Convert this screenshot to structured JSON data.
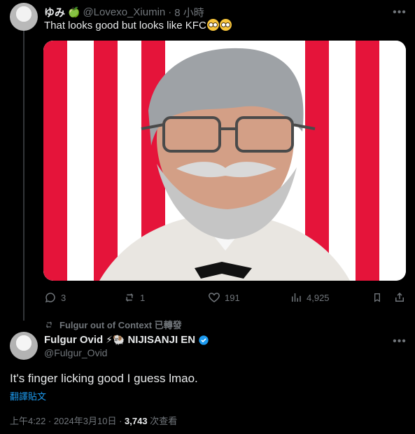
{
  "reply_tweet": {
    "display_name": "ゆみ",
    "name_emoji": "🍏",
    "handle": "@Lovexo_Xiumin",
    "separator": "·",
    "time": "8 小時",
    "text": "That looks good but looks like KFC",
    "text_emoji": [
      "🥹",
      "🥹"
    ],
    "metrics": {
      "replies": "3",
      "reposts": "1",
      "likes": "191",
      "views": "4,925"
    }
  },
  "repost_banner": {
    "text": "Fulgur out of Context 已轉發"
  },
  "main_tweet": {
    "display_name": "Fulgur Ovid",
    "name_emoji": "⚡🐏",
    "affiliation": "NIJISANJI EN",
    "handle": "@Fulgur_Ovid",
    "text": "It's finger licking good I guess lmao.",
    "translate": "翻譯貼文",
    "time": "上午4:22 · 2024年3月10日 · ",
    "views_count": "3,743",
    "views_label": " 次查看"
  },
  "colors": {
    "background": "#000000",
    "text": "#e7e9ea",
    "muted": "#71767b",
    "link": "#1d9bf0",
    "verified": "#1d9bf0",
    "stripe_red": "#e5143a"
  }
}
